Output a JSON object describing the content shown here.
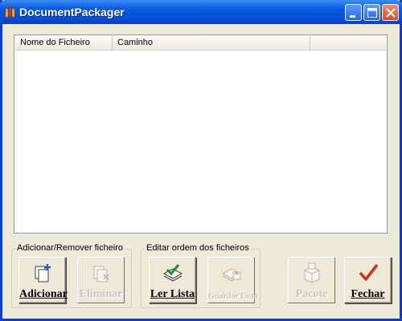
{
  "window": {
    "title": "DocumentPackager"
  },
  "list": {
    "columns": [
      "Nome do Ficheiro",
      "Caminho"
    ],
    "rows": []
  },
  "group_add_remove": {
    "title": "Adicionar/Remover ficheiro",
    "add_label": "Adicionar",
    "delete_label": "Eliminar"
  },
  "group_order": {
    "title": "Editar ordem dos ficheiros",
    "read_label": "Ler Lista",
    "save_label": "Guardar Lista"
  },
  "actions": {
    "package_label": "Pacote",
    "close_label": "Fechar"
  },
  "colors": {
    "titlebar": "#0a5be0",
    "window_bg": "#ece9d8",
    "check_red": "#c8361a",
    "disabled_text": "#c8c6bc"
  }
}
